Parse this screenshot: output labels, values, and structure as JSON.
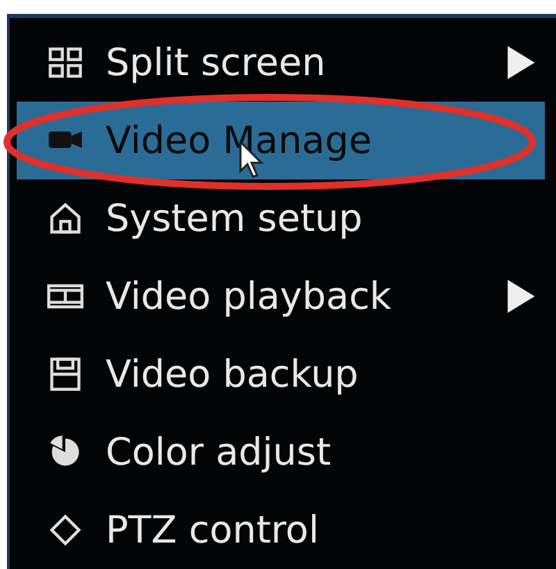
{
  "menu": {
    "items": [
      {
        "label": "Split screen",
        "selected": false,
        "submenu": true,
        "circled": false,
        "pointer": false
      },
      {
        "label": "Video Manage",
        "selected": true,
        "submenu": false,
        "circled": true,
        "pointer": true
      },
      {
        "label": "System setup",
        "selected": false,
        "submenu": false,
        "circled": false,
        "pointer": false
      },
      {
        "label": "Video playback",
        "selected": false,
        "submenu": true,
        "circled": false,
        "pointer": false
      },
      {
        "label": "Video backup",
        "selected": false,
        "submenu": false,
        "circled": false,
        "pointer": false
      },
      {
        "label": "Color adjust",
        "selected": false,
        "submenu": false,
        "circled": false,
        "pointer": false
      },
      {
        "label": "PTZ control",
        "selected": false,
        "submenu": false,
        "circled": false,
        "pointer": false
      }
    ]
  }
}
